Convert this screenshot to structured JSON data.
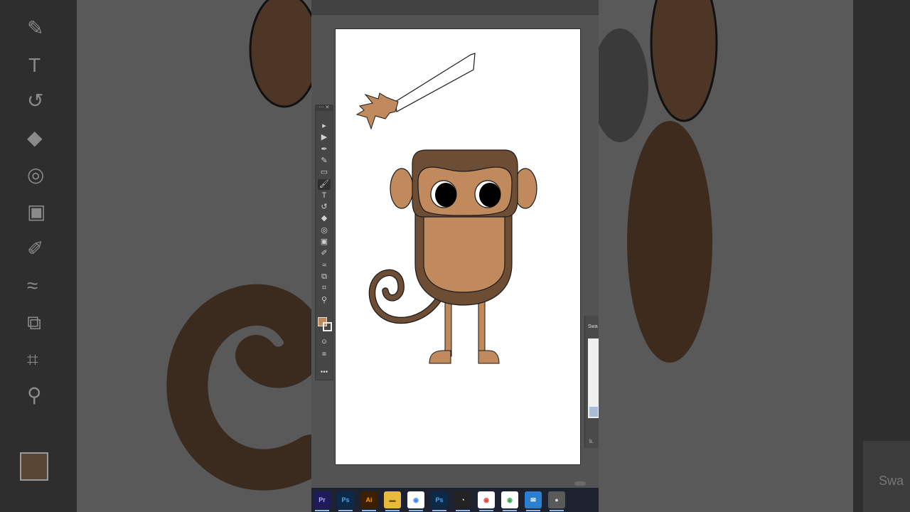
{
  "panel": {
    "title": "Swa"
  },
  "toolbar": {
    "tools": [
      {
        "name": "selection-tool",
        "glyph": "▸"
      },
      {
        "name": "direct-selection-tool",
        "glyph": "▶"
      },
      {
        "name": "pen-tool",
        "glyph": "✒"
      },
      {
        "name": "curvature-tool",
        "glyph": "✎"
      },
      {
        "name": "rectangle-tool",
        "glyph": "▭"
      },
      {
        "name": "paintbrush-tool",
        "glyph": "🖌"
      },
      {
        "name": "type-tool",
        "glyph": "T"
      },
      {
        "name": "rotate-tool",
        "glyph": "↺"
      },
      {
        "name": "eraser-tool",
        "glyph": "◆"
      },
      {
        "name": "lasso-tool",
        "glyph": "◎"
      },
      {
        "name": "gradient-tool",
        "glyph": "▣"
      },
      {
        "name": "eyedropper-tool",
        "glyph": "✐"
      },
      {
        "name": "blend-tool",
        "glyph": "≈"
      },
      {
        "name": "shape-builder-tool",
        "glyph": "⧉"
      },
      {
        "name": "artboard-tool",
        "glyph": "⌗"
      },
      {
        "name": "zoom-tool",
        "glyph": "⚲"
      }
    ],
    "active_tool": "paintbrush-tool",
    "fill_color": "#c08a5c",
    "more_label": "•••"
  },
  "taskbar": {
    "apps": [
      {
        "name": "premiere-pro",
        "label": "Pr",
        "bg": "#1f1a5c",
        "color": "#b8a5ff"
      },
      {
        "name": "photoshop",
        "label": "Ps",
        "bg": "#0b2a4a",
        "color": "#3fa9f5"
      },
      {
        "name": "illustrator",
        "label": "Ai",
        "bg": "#3b1f00",
        "color": "#ff9a00"
      },
      {
        "name": "file-explorer",
        "label": "▬",
        "bg": "#e8b93a",
        "color": "#7a5a10"
      },
      {
        "name": "chrome",
        "label": "◉",
        "bg": "#ffffff",
        "color": "#4285f4"
      },
      {
        "name": "photoshop-2",
        "label": "Ps",
        "bg": "#0b2a4a",
        "color": "#3fa9f5"
      },
      {
        "name": "screen-recorder",
        "label": "◔",
        "bg": "#222222",
        "color": "#ffffff"
      },
      {
        "name": "chrome-2",
        "label": "◉",
        "bg": "#ffffff",
        "color": "#ea4335"
      },
      {
        "name": "chrome-3",
        "label": "◉",
        "bg": "#ffffff",
        "color": "#34a853"
      },
      {
        "name": "mail",
        "label": "✉",
        "bg": "#2b7fd1",
        "color": "#ffffff"
      },
      {
        "name": "app-generic",
        "label": "●",
        "bg": "#5a5a5a",
        "color": "#dddddd"
      }
    ]
  },
  "colors": {
    "monkey_dark": "#6e4d35",
    "monkey_light": "#c08a5c",
    "outline": "#1a1a1a"
  }
}
